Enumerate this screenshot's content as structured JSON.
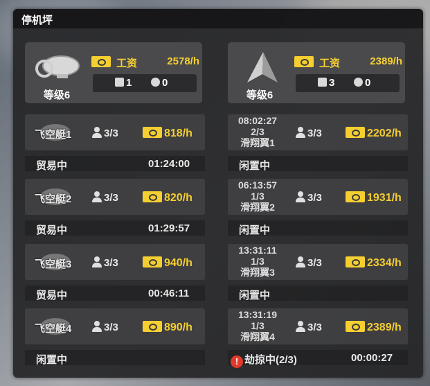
{
  "panel": {
    "title": "停机坪"
  },
  "hangars": [
    {
      "level": "等级6",
      "wage_label": "工资",
      "wage": "2578/h",
      "stat_a": "1",
      "stat_b": "0"
    },
    {
      "level": "等级6",
      "wage_label": "工资",
      "wage": "2389/h",
      "stat_a": "3",
      "stat_b": "0"
    }
  ],
  "airships": [
    {
      "name": "飞空艇1",
      "crew": "3/3",
      "income": "818/h",
      "status": "贸易中",
      "timer": "01:24:00"
    },
    {
      "name": "飞空艇2",
      "crew": "3/3",
      "income": "820/h",
      "status": "贸易中",
      "timer": "01:29:57"
    },
    {
      "name": "飞空艇3",
      "crew": "3/3",
      "income": "940/h",
      "status": "贸易中",
      "timer": "00:46:11"
    },
    {
      "name": "飞空艇4",
      "crew": "3/3",
      "income": "890/h",
      "status": "闲置中",
      "timer": ""
    }
  ],
  "gliders": [
    {
      "time": "08:02:27",
      "count": "2/3",
      "name": "滑翔翼1",
      "crew": "3/3",
      "income": "2202/h",
      "status": "闲置中",
      "timer": ""
    },
    {
      "time": "06:13:57",
      "count": "1/3",
      "name": "滑翔翼2",
      "crew": "3/3",
      "income": "1931/h",
      "status": "闲置中",
      "timer": ""
    },
    {
      "time": "13:31:11",
      "count": "1/3",
      "name": "滑翔翼3",
      "crew": "3/3",
      "income": "2334/h",
      "status": "闲置中",
      "timer": ""
    },
    {
      "time": "13:31:19",
      "count": "1/3",
      "name": "滑翔翼4",
      "crew": "3/3",
      "income": "2389/h",
      "status": "劫掠中(2/3)",
      "timer": "00:00:27"
    }
  ],
  "colors": {
    "gold": "#f5cf30",
    "alert": "#e23a2a"
  }
}
